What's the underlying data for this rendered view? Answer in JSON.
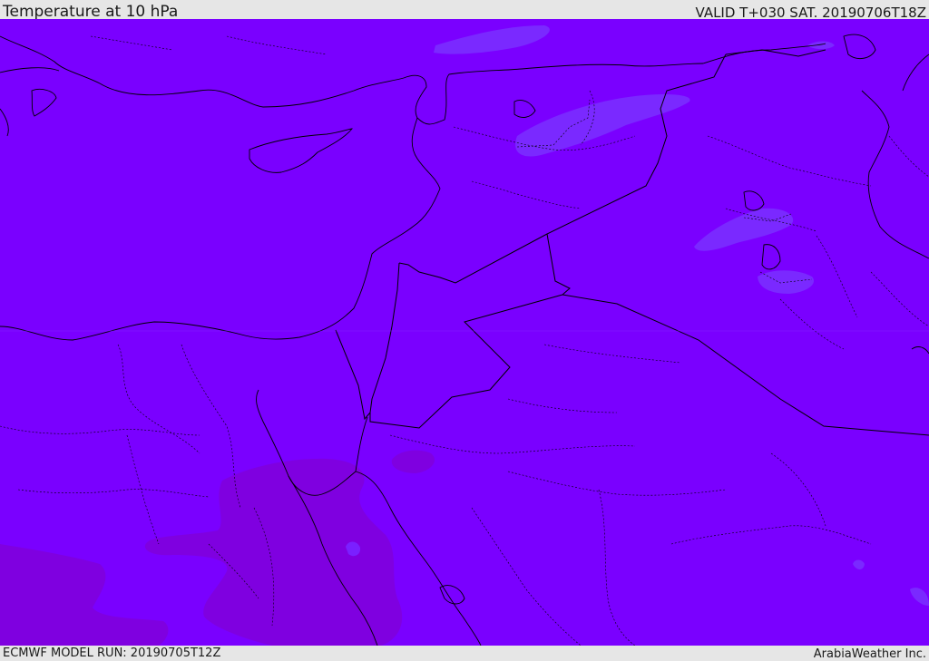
{
  "header": {
    "title": "Temperature at 10 hPa",
    "valid_time": "VALID T+030 SAT. 20190706T18Z"
  },
  "footer": {
    "model_run": "ECMWF MODEL RUN: 20190705T12Z",
    "credit": "ArabiaWeather Inc."
  },
  "map": {
    "field": "temperature",
    "level": "10 hPa",
    "colors": {
      "base_fill": "#7a00ff",
      "warm_patch": "#8000dd",
      "cool_patch": "#7a2cff",
      "borders": "#000000"
    }
  }
}
